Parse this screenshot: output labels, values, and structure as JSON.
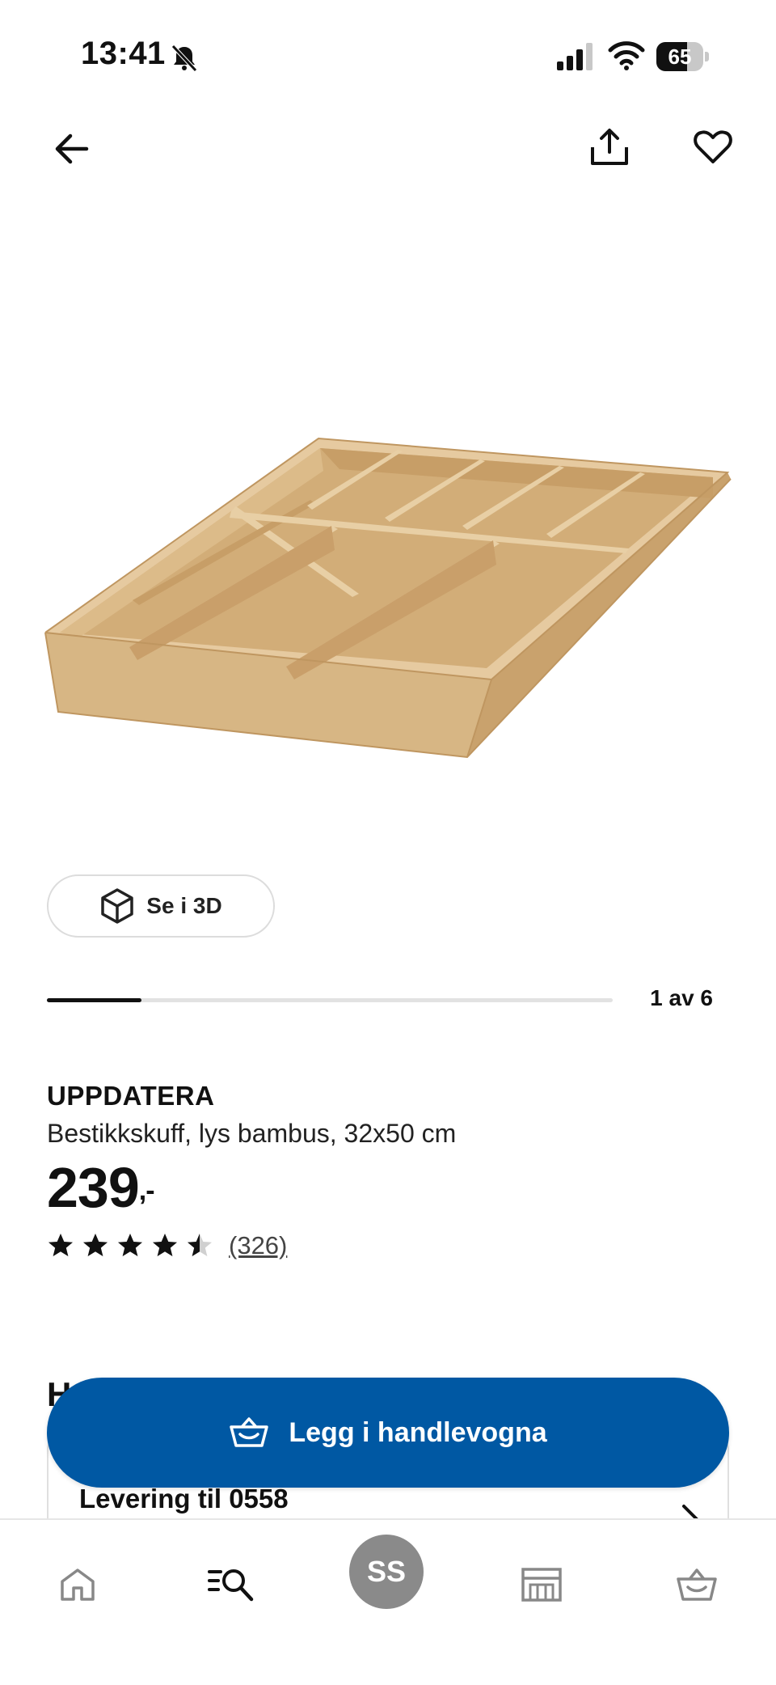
{
  "status_bar": {
    "time": "13:41",
    "battery_level": "65",
    "battery_fraction": 0.65,
    "icons": [
      "bell-muted-icon",
      "signal-icon",
      "wifi-icon",
      "battery-icon"
    ]
  },
  "top_nav": {
    "icons": [
      "arrow-left-icon",
      "share-icon",
      "heart-icon"
    ]
  },
  "gallery": {
    "view_3d_label": "Se i 3D",
    "counter": "1 av 6",
    "current": 1,
    "total": 6,
    "progress_fraction": 0.167
  },
  "product": {
    "name": "UPPDATERA",
    "description": "Bestikkskuff, lys bambus, 32x50 cm",
    "price": "239",
    "price_suffix": ",-",
    "rating": 4.5,
    "rating_max": 5,
    "review_count": "(326)"
  },
  "delivery": {
    "section_heading_visible": "H",
    "label": "Levering til 0558"
  },
  "cart_button": {
    "label": "Legg i handlevogna",
    "icon": "basket-icon"
  },
  "bottom_nav": {
    "items": [
      {
        "icon": "home-icon"
      },
      {
        "icon": "search-list-icon"
      },
      {
        "profile_initials": "SS"
      },
      {
        "icon": "store-icon"
      },
      {
        "icon": "basket-icon"
      }
    ]
  },
  "colors": {
    "accent": "#0058a3",
    "text": "#111111",
    "bamboo": "#d9b98a",
    "profile": "#8a8a8a"
  }
}
